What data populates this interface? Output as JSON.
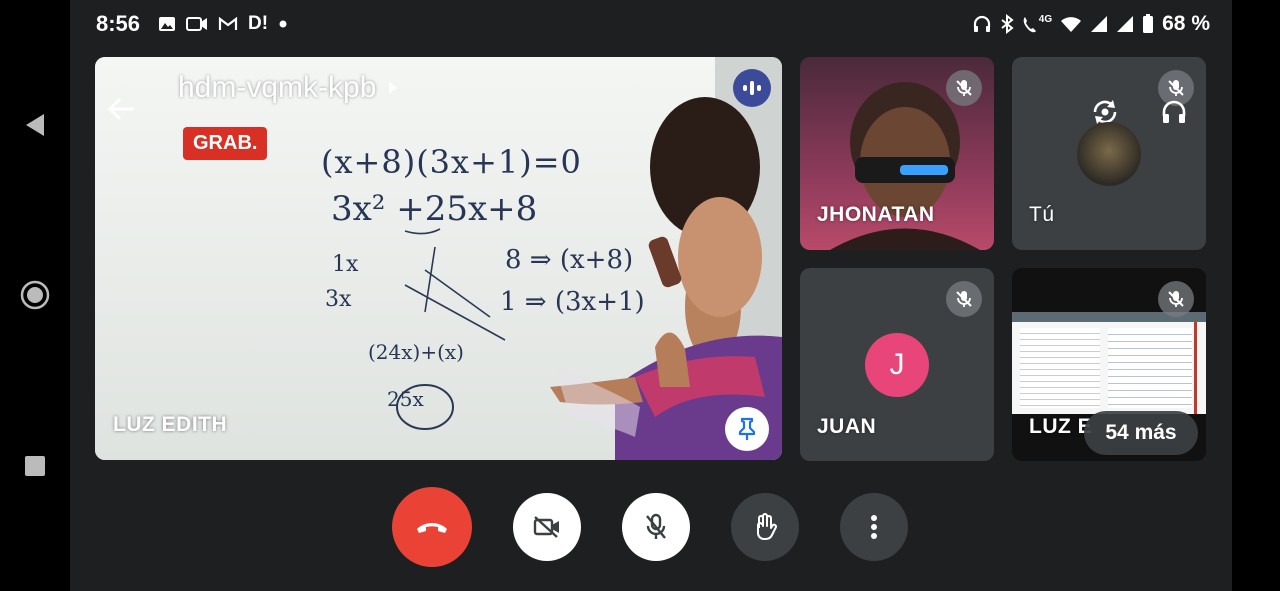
{
  "status_bar": {
    "time": "8:56",
    "left_icons": [
      "image-icon",
      "video-record-icon",
      "gmail-icon",
      "app-d-icon",
      "dot-icon"
    ],
    "app_d_label": "D!",
    "right_icons": [
      "headphones-icon",
      "bluetooth-icon",
      "wifi-call-icon",
      "wifi-icon",
      "signal-icon",
      "signal-icon",
      "battery-icon"
    ],
    "network_label": "4G",
    "battery": "68 %"
  },
  "meeting": {
    "code": "hdm-vqmk-kpb",
    "recording_badge": "GRAB."
  },
  "main_tile": {
    "participant_name": "LUZ EDITH",
    "board_lines": [
      "(x+8)(3x+1)=0",
      "3x² +25x+8",
      "1x",
      "3x",
      "8 ⇒ (x+8)",
      "1 ⇒ (3x+1)",
      "(24x)+(x)",
      "25x"
    ]
  },
  "tiles": [
    {
      "name": "JHONATAN",
      "muted": true
    },
    {
      "name": "Tú",
      "muted": true
    },
    {
      "name": "JUAN",
      "avatar_letter": "J",
      "avatar_color": "#e8457a",
      "muted": true
    },
    {
      "name": "LUZ E",
      "muted": true,
      "more_label": "54 más"
    }
  ],
  "controls": [
    "end-call",
    "camera-off",
    "mic-off",
    "raise-hand",
    "more-options"
  ],
  "colors": {
    "end_call": "#ea4335",
    "recording": "#d93025",
    "speaking_indicator": "#3c4a9a",
    "tile_bg": "#3c4043",
    "screen_bg": "#1e1f21"
  }
}
